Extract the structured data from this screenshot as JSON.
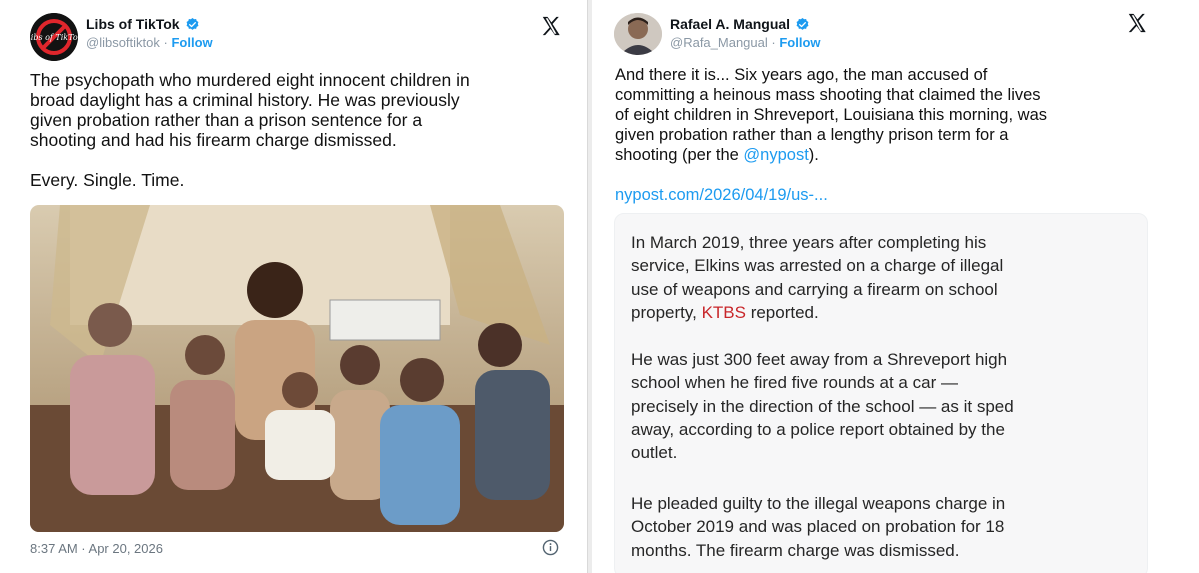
{
  "left_tweet": {
    "name": "Libs of TikTok",
    "handle": "@libsoftiktok",
    "separator": "·",
    "follow_label": "Follow",
    "avatar_text": "Libs of TikTok",
    "text_lines": [
      "The psychopath who murdered eight innocent children in",
      "broad daylight has a criminal history. He was previously",
      "given probation rather than a prison sentence for a",
      "shooting and had his firearm charge dismissed."
    ],
    "text_tail": "Every. Single. Time.",
    "timestamp": "8:37 AM · Apr 20, 2026",
    "photo_alt": "photo",
    "icons": {
      "close": "x-logo-icon",
      "verified": "verified-badge-icon",
      "info": "info-icon"
    }
  },
  "right_tweet": {
    "name": "Rafael A. Mangual",
    "handle": "@Rafa_Mangual",
    "separator": "·",
    "follow_label": "Follow",
    "text_lines": [
      "And there it is... Six years ago, the man accused of",
      "committing a heinous mass shooting that claimed the lives",
      "of eight children in Shreveport, Louisiana this morning, was",
      "given probation rather than a lengthy prison term for a"
    ],
    "text_last_prefix": "shooting (per the ",
    "mention": "@nypost",
    "text_last_suffix": ").",
    "link": "nypost.com/2026/04/19/us-...",
    "quote": {
      "p1_lines": [
        "In March 2019, three years after completing his",
        "service, Elkins was arrested on a charge of illegal",
        "use of weapons and carrying a firearm on school"
      ],
      "p1_last_prefix": "property, ",
      "p1_source": "KTBS",
      "p1_last_suffix": " reported.",
      "p2_lines": [
        "He was just 300 feet away from a Shreveport high",
        "school when he fired five rounds at a car —",
        "precisely in the direction of the school — as it sped",
        "away, according to a police report obtained by the",
        "outlet."
      ],
      "p3_lines": [
        "He pleaded guilty to the illegal weapons charge in",
        "October 2019 and was placed on probation for 18",
        "months. The firearm charge was dismissed."
      ]
    }
  },
  "colors": {
    "accent": "#1d9bf0",
    "ktbs": "#c8262a",
    "text": "#0f1419",
    "muted": "#8b98a5"
  }
}
